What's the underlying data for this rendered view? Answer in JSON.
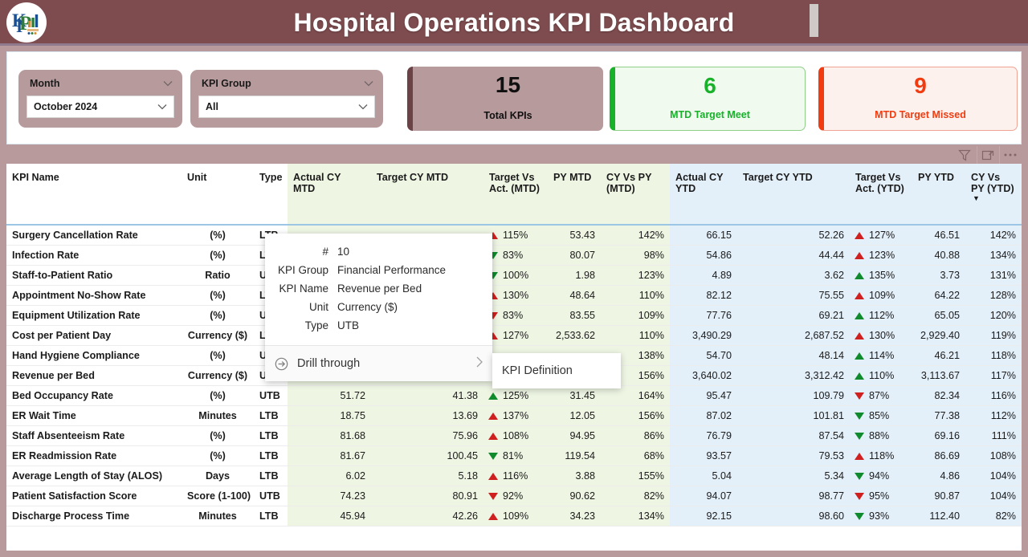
{
  "header": {
    "title": "Hospital Operations KPI Dashboard",
    "logo_icon": "kpi-logo-icon",
    "bar_color": "#7e4c4f"
  },
  "filters": {
    "month": {
      "label": "Month",
      "value": "October 2024",
      "caret_icon": "chevron-down-icon"
    },
    "kpi_group": {
      "label": "KPI Group",
      "value": "All",
      "caret_icon": "chevron-down-icon"
    }
  },
  "cards": [
    {
      "value": "15",
      "label": "Total KPIs",
      "accent": "#6b4245",
      "text_color": "#101010"
    },
    {
      "value": "6",
      "label": "MTD Target Meet",
      "accent": "#17b12a",
      "text_color": "#17b12a"
    },
    {
      "value": "9",
      "label": "MTD Target Missed",
      "accent": "#f03c10",
      "text_color": "#f03c10"
    }
  ],
  "visual_tools": [
    {
      "icon": "filter-icon"
    },
    {
      "icon": "focus-mode-icon"
    },
    {
      "icon": "more-options-icon"
    }
  ],
  "table": {
    "columns": [
      {
        "label": "KPI Name",
        "group": "base"
      },
      {
        "label": "Unit",
        "group": "base"
      },
      {
        "label": "Type",
        "group": "base"
      },
      {
        "label": "Actual CY MTD",
        "group": "mtd"
      },
      {
        "label": "Target CY MTD",
        "group": "mtd"
      },
      {
        "label": "Target Vs Act. (MTD)",
        "group": "mtd"
      },
      {
        "label": "PY MTD",
        "group": "mtd"
      },
      {
        "label": "CY Vs PY (MTD)",
        "group": "mtd"
      },
      {
        "label": "Actual CY YTD",
        "group": "ytd"
      },
      {
        "label": "Target CY YTD",
        "group": "ytd"
      },
      {
        "label": "Target Vs Act. (YTD)",
        "group": "ytd"
      },
      {
        "label": "PY YTD",
        "group": "ytd"
      },
      {
        "label": "CY Vs PY (YTD)",
        "group": "ytd",
        "sort_icon": "sort-descending-icon"
      }
    ],
    "rows": [
      {
        "name": "Surgery Cancellation Rate",
        "unit": "(%)",
        "type": "LTB",
        "actual_mtd": "",
        "target_mtd": "",
        "tva_mtd": "115%",
        "tva_mtd_dir": "up",
        "tva_mtd_color": "red",
        "py_mtd": "53.43",
        "cypy_mtd": "142%",
        "actual_ytd": "66.15",
        "target_ytd": "52.26",
        "tva_ytd": "127%",
        "tva_ytd_dir": "up",
        "tva_ytd_color": "red",
        "py_ytd": "46.51",
        "cypy_ytd": "142%"
      },
      {
        "name": "Infection Rate",
        "unit": "(%)",
        "type": "LTB",
        "actual_mtd": "",
        "target_mtd": "",
        "tva_mtd": "83%",
        "tva_mtd_dir": "down",
        "tva_mtd_color": "green",
        "py_mtd": "80.07",
        "cypy_mtd": "98%",
        "actual_ytd": "54.86",
        "target_ytd": "44.44",
        "tva_ytd": "123%",
        "tva_ytd_dir": "up",
        "tva_ytd_color": "red",
        "py_ytd": "40.88",
        "cypy_ytd": "134%"
      },
      {
        "name": "Staff-to-Patient Ratio",
        "unit": "Ratio",
        "type": "UTB",
        "actual_mtd": "",
        "target_mtd": "",
        "tva_mtd": "100%",
        "tva_mtd_dir": "down",
        "tva_mtd_color": "green",
        "py_mtd": "1.98",
        "cypy_mtd": "123%",
        "actual_ytd": "4.89",
        "target_ytd": "3.62",
        "tva_ytd": "135%",
        "tva_ytd_dir": "up",
        "tva_ytd_color": "green",
        "py_ytd": "3.73",
        "cypy_ytd": "131%"
      },
      {
        "name": "Appointment No-Show Rate",
        "unit": "(%)",
        "type": "LTB",
        "actual_mtd": "",
        "target_mtd": "",
        "tva_mtd": "130%",
        "tva_mtd_dir": "up",
        "tva_mtd_color": "red",
        "py_mtd": "48.64",
        "cypy_mtd": "110%",
        "actual_ytd": "82.12",
        "target_ytd": "75.55",
        "tva_ytd": "109%",
        "tva_ytd_dir": "up",
        "tva_ytd_color": "red",
        "py_ytd": "64.22",
        "cypy_ytd": "128%"
      },
      {
        "name": "Equipment Utilization Rate",
        "unit": "(%)",
        "type": "UTB",
        "actual_mtd": "",
        "target_mtd": "",
        "tva_mtd": "83%",
        "tva_mtd_dir": "down",
        "tva_mtd_color": "red",
        "py_mtd": "83.55",
        "cypy_mtd": "109%",
        "actual_ytd": "77.76",
        "target_ytd": "69.21",
        "tva_ytd": "112%",
        "tva_ytd_dir": "up",
        "tva_ytd_color": "green",
        "py_ytd": "65.05",
        "cypy_ytd": "120%"
      },
      {
        "name": "Cost per Patient Day",
        "unit": "Currency ($)",
        "type": "LTB",
        "actual_mtd": "",
        "target_mtd": "",
        "tva_mtd": "127%",
        "tva_mtd_dir": "up",
        "tva_mtd_color": "red",
        "py_mtd": "2,533.62",
        "cypy_mtd": "110%",
        "actual_ytd": "3,490.29",
        "target_ytd": "2,687.52",
        "tva_ytd": "130%",
        "tva_ytd_dir": "up",
        "tva_ytd_color": "red",
        "py_ytd": "2,929.40",
        "cypy_ytd": "119%"
      },
      {
        "name": "Hand Hygiene Compliance",
        "unit": "(%)",
        "type": "UTB",
        "actual_mtd": "",
        "target_mtd": "",
        "tva_mtd": "",
        "tva_mtd_dir": "",
        "tva_mtd_color": "",
        "py_mtd": "",
        "cypy_mtd": "138%",
        "actual_ytd": "54.70",
        "target_ytd": "48.14",
        "tva_ytd": "114%",
        "tva_ytd_dir": "up",
        "tva_ytd_color": "green",
        "py_ytd": "46.21",
        "cypy_ytd": "118%"
      },
      {
        "name": "Revenue per Bed",
        "unit": "Currency ($)",
        "type": "UTB",
        "actual_mtd": "",
        "target_mtd": "",
        "tva_mtd": "",
        "tva_mtd_dir": "",
        "tva_mtd_color": "",
        "py_mtd": "",
        "cypy_mtd": "156%",
        "actual_ytd": "3,640.02",
        "target_ytd": "3,312.42",
        "tva_ytd": "110%",
        "tva_ytd_dir": "up",
        "tva_ytd_color": "green",
        "py_ytd": "3,113.67",
        "cypy_ytd": "117%"
      },
      {
        "name": "Bed Occupancy Rate",
        "unit": "(%)",
        "type": "UTB",
        "actual_mtd": "51.72",
        "target_mtd": "41.38",
        "tva_mtd": "125%",
        "tva_mtd_dir": "up",
        "tva_mtd_color": "green",
        "py_mtd": "31.45",
        "cypy_mtd": "164%",
        "actual_ytd": "95.47",
        "target_ytd": "109.79",
        "tva_ytd": "87%",
        "tva_ytd_dir": "down",
        "tva_ytd_color": "red",
        "py_ytd": "82.34",
        "cypy_ytd": "116%"
      },
      {
        "name": "ER Wait Time",
        "unit": "Minutes",
        "type": "LTB",
        "actual_mtd": "18.75",
        "target_mtd": "13.69",
        "tva_mtd": "137%",
        "tva_mtd_dir": "up",
        "tva_mtd_color": "red",
        "py_mtd": "12.05",
        "cypy_mtd": "156%",
        "actual_ytd": "87.02",
        "target_ytd": "101.81",
        "tva_ytd": "85%",
        "tva_ytd_dir": "down",
        "tva_ytd_color": "green",
        "py_ytd": "77.38",
        "cypy_ytd": "112%"
      },
      {
        "name": "Staff Absenteeism Rate",
        "unit": "(%)",
        "type": "LTB",
        "actual_mtd": "81.68",
        "target_mtd": "75.96",
        "tva_mtd": "108%",
        "tva_mtd_dir": "up",
        "tva_mtd_color": "red",
        "py_mtd": "94.95",
        "cypy_mtd": "86%",
        "actual_ytd": "76.79",
        "target_ytd": "87.54",
        "tva_ytd": "88%",
        "tva_ytd_dir": "down",
        "tva_ytd_color": "green",
        "py_ytd": "69.16",
        "cypy_ytd": "111%"
      },
      {
        "name": "ER Readmission Rate",
        "unit": "(%)",
        "type": "LTB",
        "actual_mtd": "81.67",
        "target_mtd": "100.45",
        "tva_mtd": "81%",
        "tva_mtd_dir": "down",
        "tva_mtd_color": "green",
        "py_mtd": "119.54",
        "cypy_mtd": "68%",
        "actual_ytd": "93.57",
        "target_ytd": "79.53",
        "tva_ytd": "118%",
        "tva_ytd_dir": "up",
        "tva_ytd_color": "red",
        "py_ytd": "86.69",
        "cypy_ytd": "108%"
      },
      {
        "name": "Average Length of Stay (ALOS)",
        "unit": "Days",
        "type": "LTB",
        "actual_mtd": "6.02",
        "target_mtd": "5.18",
        "tva_mtd": "116%",
        "tva_mtd_dir": "up",
        "tva_mtd_color": "red",
        "py_mtd": "3.88",
        "cypy_mtd": "155%",
        "actual_ytd": "5.04",
        "target_ytd": "5.34",
        "tva_ytd": "94%",
        "tva_ytd_dir": "down",
        "tva_ytd_color": "green",
        "py_ytd": "4.86",
        "cypy_ytd": "104%"
      },
      {
        "name": "Patient Satisfaction Score",
        "unit": "Score (1-100)",
        "type": "UTB",
        "actual_mtd": "74.23",
        "target_mtd": "80.91",
        "tva_mtd": "92%",
        "tva_mtd_dir": "down",
        "tva_mtd_color": "red",
        "py_mtd": "90.62",
        "cypy_mtd": "82%",
        "actual_ytd": "94.07",
        "target_ytd": "98.77",
        "tva_ytd": "95%",
        "tva_ytd_dir": "down",
        "tva_ytd_color": "red",
        "py_ytd": "90.87",
        "cypy_ytd": "104%"
      },
      {
        "name": "Discharge Process Time",
        "unit": "Minutes",
        "type": "LTB",
        "actual_mtd": "45.94",
        "target_mtd": "42.26",
        "tva_mtd": "109%",
        "tva_mtd_dir": "up",
        "tva_mtd_color": "red",
        "py_mtd": "34.23",
        "cypy_mtd": "134%",
        "actual_ytd": "92.15",
        "target_ytd": "98.60",
        "tva_ytd": "93%",
        "tva_ytd_dir": "down",
        "tva_ytd_color": "green",
        "py_ytd": "112.40",
        "cypy_ytd": "82%"
      }
    ]
  },
  "context_menu": {
    "fields": [
      {
        "key": "#",
        "value": "10"
      },
      {
        "key": "KPI Group",
        "value": "Financial Performance"
      },
      {
        "key": "KPI Name",
        "value": "Revenue per Bed"
      },
      {
        "key": "Unit",
        "value": "Currency ($)"
      },
      {
        "key": "Type",
        "value": "UTB"
      }
    ],
    "action": {
      "label": "Drill through",
      "icon": "drill-through-icon",
      "chevron": "chevron-right-icon"
    },
    "submenu": {
      "label": "KPI Definition"
    }
  }
}
